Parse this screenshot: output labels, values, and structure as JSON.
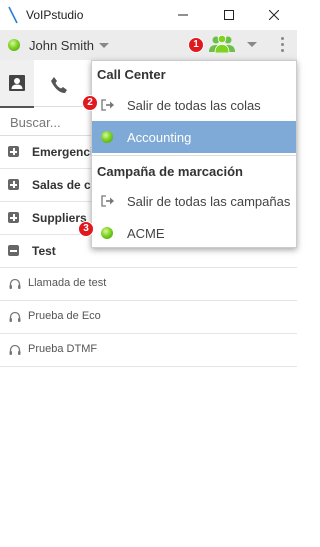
{
  "window": {
    "title": "VoIPstudio",
    "accent": "#7ed321"
  },
  "userbar": {
    "user_name": "John Smith",
    "status_color": "#7ed321"
  },
  "search": {
    "placeholder": "Buscar..."
  },
  "contact_groups": [
    {
      "label": "Emergencias",
      "expanded": false
    },
    {
      "label": "Salas de conferencia",
      "expanded": false
    },
    {
      "label": "Suppliers",
      "expanded": false
    },
    {
      "label": "Test",
      "expanded": true
    }
  ],
  "test_items": [
    {
      "label": "Llamada de test"
    },
    {
      "label": "Prueba de Eco"
    },
    {
      "label": "Prueba DTMF"
    }
  ],
  "dropdown": {
    "call_center_header": "Call Center",
    "exit_queues_label": "Salir de todas las colas",
    "queue_label": "Accounting",
    "campaign_header": "Campaña de marcación",
    "exit_campaigns_label": "Salir de todas las campañas",
    "campaign_label": "ACME",
    "selected_color": "#7fa9d6"
  },
  "badges": {
    "one": "1",
    "two": "2",
    "three": "3",
    "color": "#e0191e"
  }
}
